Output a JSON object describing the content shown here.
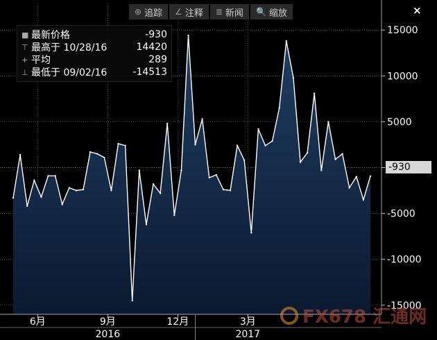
{
  "toolbar": {
    "items": [
      {
        "label": "追踪",
        "icon": "crosshair-icon",
        "glyph": "⊕"
      },
      {
        "label": "注释",
        "icon": "annotate-icon",
        "glyph": "∠"
      },
      {
        "label": "新闻",
        "icon": "news-icon",
        "glyph": "≣"
      },
      {
        "label": "缩放",
        "icon": "zoom-icon",
        "glyph": "🔍"
      }
    ],
    "close": "×"
  },
  "legend": {
    "rows": [
      {
        "icon": "series-square-icon",
        "glyph": "■",
        "label": "最新价格",
        "value": "-930"
      },
      {
        "icon": "high-marker-icon",
        "glyph": "⊤",
        "label": "最高于 10/28/16",
        "value": "14420"
      },
      {
        "icon": "average-marker-icon",
        "glyph": "+",
        "label": "平均",
        "value": "289"
      },
      {
        "icon": "low-marker-icon",
        "glyph": "⊥",
        "label": "最低于 09/02/16",
        "value": "-14513"
      }
    ]
  },
  "last_value_label": "-930",
  "watermark": "FX678 汇通网",
  "colors": {
    "background": "#000000",
    "area_top": "#1f3d63",
    "area_bottom": "#0b1a30",
    "line": "#ffffff",
    "grid": "#444444"
  },
  "chart_data": {
    "type": "area",
    "title": "",
    "xlabel": "",
    "ylabel": "",
    "ylim": [
      -16000,
      16000
    ],
    "yticks": [
      15000,
      10000,
      5000,
      0,
      -5000,
      -10000,
      -15000
    ],
    "ytick_labels": [
      "15000",
      "10000",
      "5000",
      "0",
      "-5000",
      "-10000",
      "-15000"
    ],
    "xticks": [
      {
        "index": 3.5,
        "label": "6月"
      },
      {
        "index": 13.5,
        "label": "9月"
      },
      {
        "index": 23.5,
        "label": "12月"
      },
      {
        "index": 33.5,
        "label": "3月"
      }
    ],
    "year_labels": [
      {
        "index": 13.5,
        "label": "2016"
      },
      {
        "index": 33.5,
        "label": "2017"
      }
    ],
    "year_separators": [
      26
    ],
    "grid": true,
    "legend_position": "top-left",
    "series": [
      {
        "values": [
          -3300,
          1400,
          -4200,
          -1400,
          -3200,
          -900,
          -900,
          -4000,
          -2200,
          -2500,
          -2400,
          1700,
          1500,
          1100,
          -2500,
          2600,
          2400,
          -14513,
          -300,
          -6200,
          -1800,
          -2800,
          4800,
          -5200,
          -300,
          14420,
          2500,
          5300,
          -1100,
          -800,
          -2400,
          -2500,
          2400,
          800,
          -7100,
          4200,
          2400,
          2900,
          6500,
          13800,
          9800,
          600,
          1600,
          8100,
          -300,
          5000,
          900,
          1500,
          -2200,
          -1000,
          -3500,
          -930
        ]
      }
    ]
  }
}
